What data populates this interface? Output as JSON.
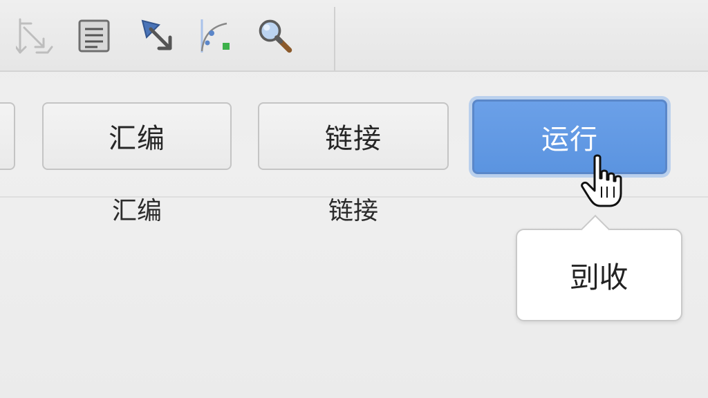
{
  "toolbar": {
    "tools": [
      {
        "icon": "route-arrows-icon"
      },
      {
        "icon": "list-document-icon"
      },
      {
        "icon": "diagonal-arrow-icon"
      },
      {
        "icon": "curve-points-icon"
      },
      {
        "icon": "magnifier-icon"
      }
    ]
  },
  "actions": {
    "assemble_label": "汇编",
    "link_label": "链接",
    "run_label": "运行",
    "assemble_caption": "汇编",
    "link_caption": "链接"
  },
  "tooltip": {
    "text": "剅收"
  },
  "colors": {
    "run_button": "#5b94e0",
    "run_focus_ring": "#7baaeb",
    "toolbar_bg": "#e8e8e8"
  }
}
